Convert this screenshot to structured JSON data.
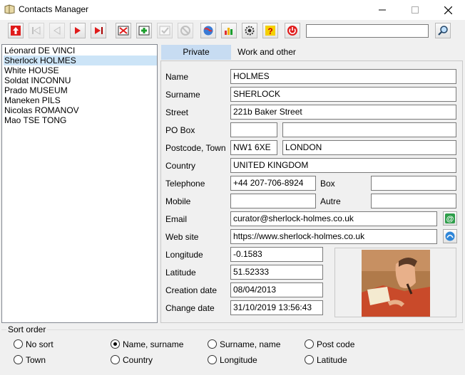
{
  "window": {
    "title": "Contacts Manager"
  },
  "search": {
    "value": ""
  },
  "contacts": [
    "Léonard DE VINCI",
    "Sherlock HOLMES",
    "White HOUSE",
    "Soldat INCONNU",
    "Prado MUSEUM",
    "Maneken PILS",
    "Nicolas ROMANOV",
    "Mao TSE TONG"
  ],
  "selected_contact": "Sherlock HOLMES",
  "tabs": {
    "private": "Private",
    "work": "Work and other"
  },
  "labels": {
    "name": "Name",
    "surname": "Surname",
    "street": "Street",
    "po_box": "PO Box",
    "postcode_town": "Postcode, Town",
    "country": "Country",
    "telephone": "Telephone",
    "box": "Box",
    "mobile": "Mobile",
    "autre": "Autre",
    "email": "Email",
    "website": "Web site",
    "longitude": "Longitude",
    "latitude": "Latitude",
    "creation_date": "Creation date",
    "change_date": "Change date"
  },
  "fields": {
    "name": "HOLMES",
    "surname": "SHERLOCK",
    "street": "221b Baker Street",
    "po_box_1": "",
    "po_box_2": "",
    "postcode": "NW1 6XE",
    "town": "LONDON",
    "country": "UNITED KINGDOM",
    "telephone": "+44 207-706-8924",
    "box": "",
    "mobile": "",
    "autre": "",
    "email": "curator@sherlock-holmes.co.uk",
    "website": "https://www.sherlock-holmes.co.uk",
    "longitude": "-0.1583",
    "latitude": "51.52333",
    "creation_date": "08/04/2013",
    "change_date": "31/10/2019 13:56:43"
  },
  "sort": {
    "title": "Sort order",
    "options": [
      "No sort",
      "Name, surname",
      "Surname, name",
      "Post code",
      "Town",
      "Country",
      "Longitude",
      "Latitude"
    ],
    "selected": "Name, surname"
  },
  "colors": {
    "selection": "#cce4f7",
    "active_tab": "#c7dcf2",
    "toolbar_red": "#e01b1b",
    "toolbar_green": "#1b9e2b"
  }
}
